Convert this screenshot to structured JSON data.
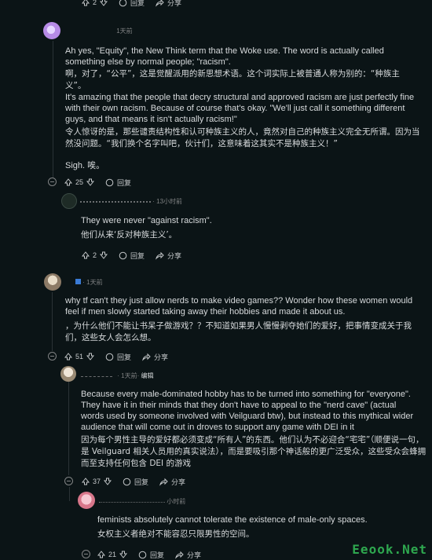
{
  "top_actions": {
    "upvotes": "2",
    "reply": "回复",
    "share": "分享"
  },
  "comment1": {
    "time": "1天前",
    "p1": "Ah yes, \"Equity\", the New Think term that the Woke use. The word is actually called something else by normal people; \"racism\".",
    "p1_cn": "啊，对了，“公平”，这是觉醒派用的新思想术语。这个词实际上被普通人称为别的：“种族主义”。",
    "p2": "It's amazing that the people that decry structural and approved racism are just perfectly fine with their own racism. Because of course that's okay. \"We'll just call it something different guys, and that means it isn't actually racism!\"",
    "p2_cn": "令人惊讶的是，那些谴责结构性和认可种族主义的人，竟然对自己的种族主义完全无所谓。因为当然没问题。“我们换个名字叫吧，伙计们，这意味着这其实不是种族主义！”",
    "p3": "Sigh.  唉。",
    "upvotes": "25",
    "reply": "回复"
  },
  "reply1": {
    "time": "· 13小时前",
    "text": "They were never \"against racism\".",
    "text_cn": "他们从来‘反对种族主义’。",
    "upvotes": "2",
    "reply": "回复",
    "share": "分享"
  },
  "comment2": {
    "time": "· 1天前",
    "text": "why tf can't they just allow nerds to make video games?? Wonder how these women would feel if men slowly started taking away their hobbies and made it about us.",
    "text_cn": "，为什么他们不能让书呆子做游戏？？不知道如果男人慢慢剥夺她们的爱好，把事情变成关于我们，这些女人会怎么想。",
    "upvotes": "51",
    "reply": "回复",
    "share": "分享"
  },
  "reply2": {
    "time": "· 1天前·",
    "edited": "编辑",
    "text": "Because every male-dominated hobby has to be turned into something for \"everyone\". They have it in their minds that they don't have to appeal to the \"nerd cave\" (actual words used by someone involved with Veilguard btw), but instead to this mythical wider audience that will come out in droves to support any game with DEI in it",
    "text_cn": "因为每个男性主导的爱好都必须变成“所有人”的东西。他们认为不必迎合“宅宅”（顺便说一句，是 Veilguard 相关人员用的真实说法），而是要吸引那个神话般的更广泛受众，这些受众会蜂拥而至支持任何包含 DEI 的游戏",
    "upvotes": "37",
    "reply": "回复",
    "share": "分享"
  },
  "reply3": {
    "time": "小时前",
    "text": "feminists absolutely cannot tolerate the existence of male-only spaces.",
    "text_cn": "女权主义者绝对不能容忍只限男性的空间。",
    "upvotes": "21",
    "reply": "回复",
    "share": "分享"
  },
  "watermark": "Eeook.Net",
  "colors": {
    "background": "#0b1416",
    "text": "#d7dadc",
    "muted": "#818384",
    "watermark": "#2ea84f"
  }
}
